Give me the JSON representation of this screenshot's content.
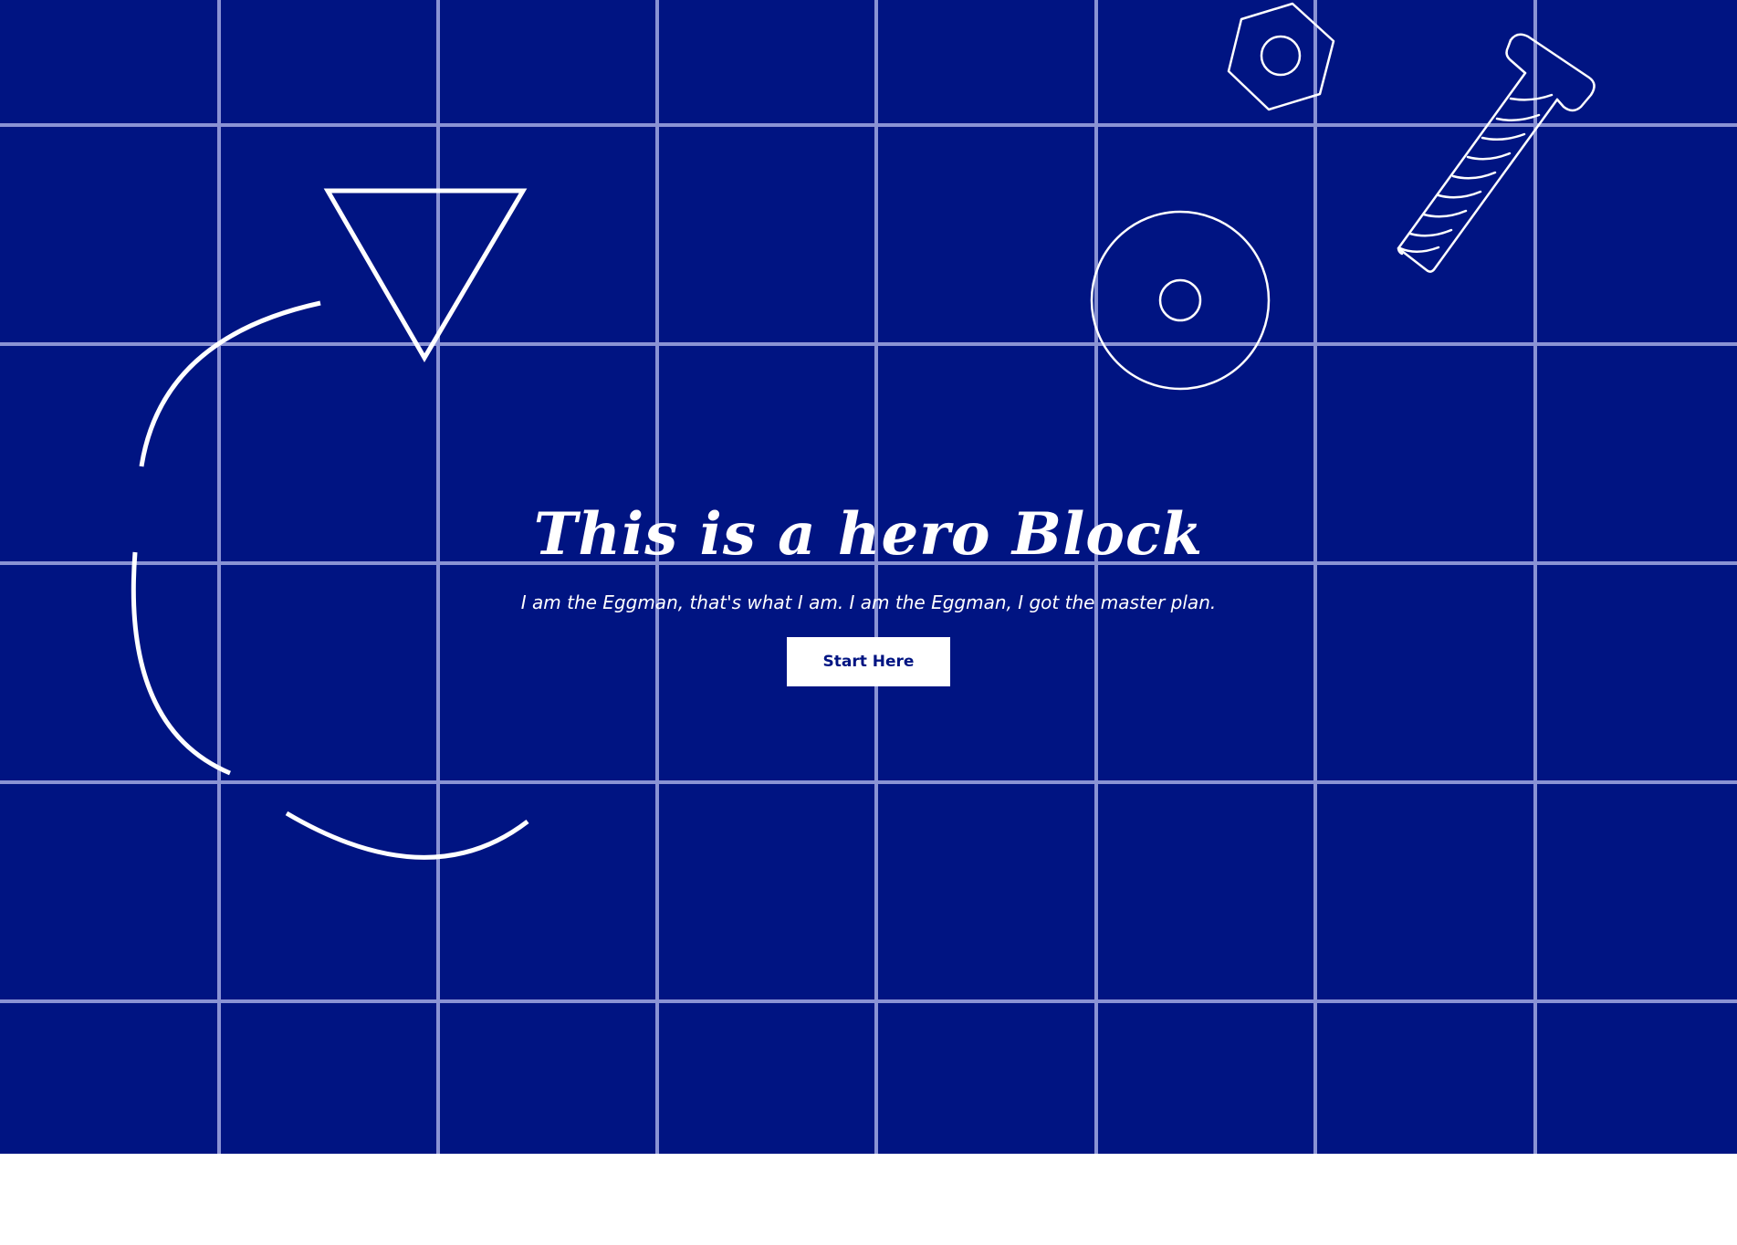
{
  "hero": {
    "title": "This is a hero Block",
    "subtitle": "I am the Eggman, that's what I am. I am the Eggman, I got the master plan.",
    "button_label": "Start Here"
  },
  "colors": {
    "background": "#001482",
    "grid_line": "#8a93d4",
    "foreground": "#ffffff"
  },
  "decorations": [
    "triangle-outline",
    "broken-circle-arcs",
    "hex-nut-icon",
    "bolt-icon",
    "washer-icon"
  ]
}
